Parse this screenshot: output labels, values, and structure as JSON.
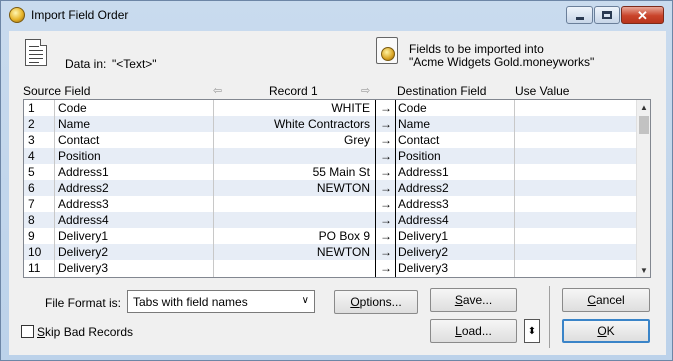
{
  "window": {
    "title": "Import Field Order",
    "close_glyph": "✕"
  },
  "info": {
    "data_in_label": "Data in:",
    "data_in_value": "\"<Text>\"",
    "dest_line1": "Fields to be imported into",
    "dest_line2": "\"Acme Widgets Gold.moneyworks\""
  },
  "columns": {
    "source": "Source Field",
    "record": "Record 1",
    "destination": "Destination Field",
    "use_value": "Use Value",
    "prev_arrow": "⇦",
    "next_arrow": "⇨"
  },
  "rows": [
    {
      "num": "1",
      "source": "Code",
      "record": "WHITE",
      "arrow": "→",
      "dest": "Code"
    },
    {
      "num": "2",
      "source": "Name",
      "record": "White Contractors",
      "arrow": "→",
      "dest": "Name"
    },
    {
      "num": "3",
      "source": "Contact",
      "record": "Grey",
      "arrow": "→",
      "dest": "Contact"
    },
    {
      "num": "4",
      "source": "Position",
      "record": "",
      "arrow": "→",
      "dest": "Position"
    },
    {
      "num": "5",
      "source": "Address1",
      "record": "55 Main St",
      "arrow": "→",
      "dest": "Address1"
    },
    {
      "num": "6",
      "source": "Address2",
      "record": "NEWTON",
      "arrow": "→",
      "dest": "Address2"
    },
    {
      "num": "7",
      "source": "Address3",
      "record": "",
      "arrow": "→",
      "dest": "Address3"
    },
    {
      "num": "8",
      "source": "Address4",
      "record": "",
      "arrow": "→",
      "dest": "Address4"
    },
    {
      "num": "9",
      "source": "Delivery1",
      "record": "PO Box 9",
      "arrow": "→",
      "dest": "Delivery1"
    },
    {
      "num": "10",
      "source": "Delivery2",
      "record": "NEWTON",
      "arrow": "→",
      "dest": "Delivery2"
    },
    {
      "num": "11",
      "source": "Delivery3",
      "record": "",
      "arrow": "→",
      "dest": "Delivery3"
    }
  ],
  "footer": {
    "file_format_label": "File Format is:",
    "file_format_value": "Tabs with field names",
    "options_key": "O",
    "options_rest": "ptions...",
    "save_key": "S",
    "save_rest": "ave...",
    "load_key": "L",
    "load_rest": "oad...",
    "cancel_key": "C",
    "cancel_rest": "ancel",
    "ok_key": "O",
    "ok_rest": "K",
    "skip_key": "S",
    "skip_rest": "kip Bad Records",
    "spinner_glyph": "⬍"
  },
  "icons": {
    "app": "moneyworks-coin-icon",
    "doc": "text-document-icon",
    "target": "moneyworks-file-icon"
  }
}
